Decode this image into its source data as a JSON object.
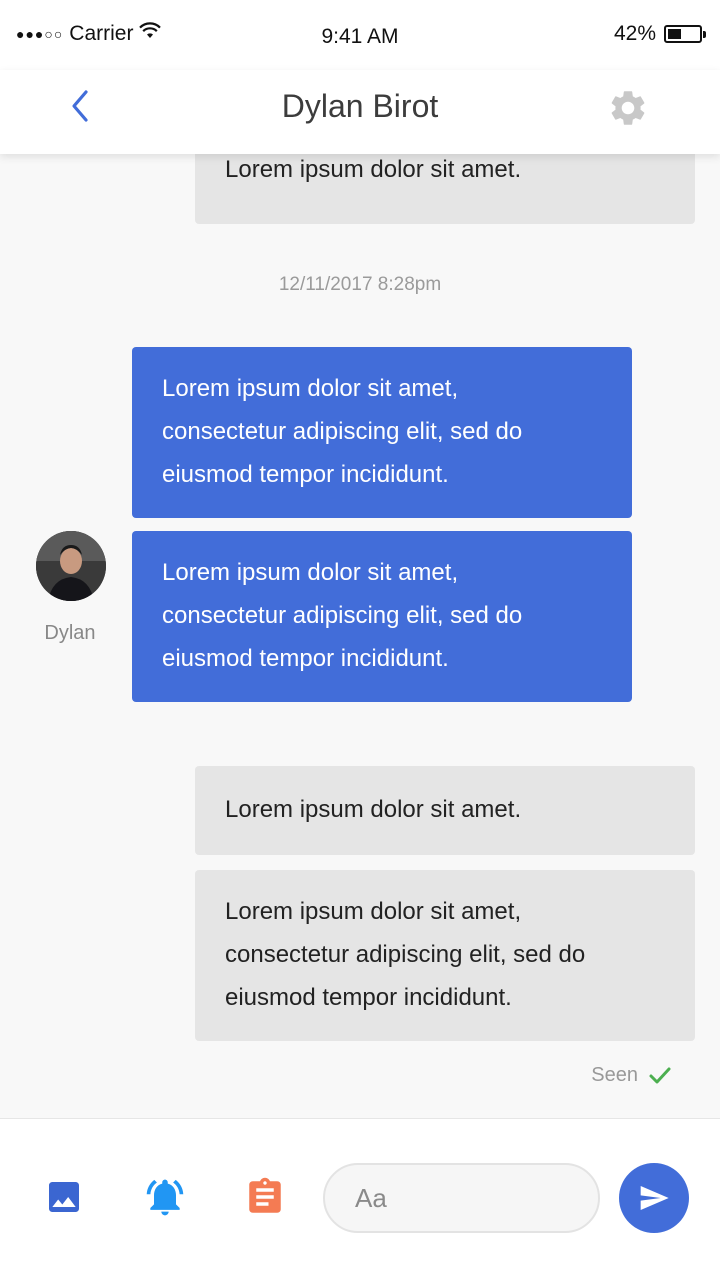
{
  "status_bar": {
    "signal": "●●●○○",
    "carrier": "Carrier",
    "time": "9:41 AM",
    "battery_percent": "42%",
    "battery_level": 0.42
  },
  "header": {
    "title": "Dylan Birot",
    "back_icon": "chevron-left-icon",
    "settings_icon": "gear-icon"
  },
  "conversation": {
    "messages_top": [
      {
        "lines": [
          "Lorem ipsum dolor sit amet."
        ]
      }
    ],
    "timestamp": "12/11/2017 8:28pm",
    "incoming": {
      "sender_name": "Dylan",
      "messages": [
        {
          "lines": [
            "Lorem ipsum dolor sit amet,",
            "consectetur adipiscing elit, sed do",
            "eiusmod tempor incididunt."
          ]
        },
        {
          "lines": [
            "Lorem ipsum dolor sit amet,",
            "consectetur adipiscing elit, sed do",
            "eiusmod tempor incididunt."
          ]
        }
      ]
    },
    "outgoing": [
      {
        "lines": [
          "Lorem ipsum dolor sit amet."
        ]
      },
      {
        "lines": [
          "Lorem ipsum dolor sit amet,",
          "consectetur adipiscing elit, sed do",
          "eiusmod tempor incididunt."
        ]
      }
    ],
    "seen_label": "Seen"
  },
  "composer": {
    "placeholder": "Aa",
    "tools": [
      "image-icon",
      "bell-icon",
      "clipboard-icon"
    ],
    "send_icon": "send-icon"
  },
  "colors": {
    "accent": "#426dd9",
    "bubble_gray": "#e5e5e5",
    "bell": "#2196f3",
    "clipboard": "#f47b53",
    "image": "#3b66d1",
    "seen_check": "#4caf50"
  }
}
